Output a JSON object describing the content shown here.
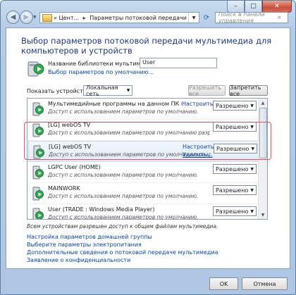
{
  "window": {
    "minimize_glyph": "–",
    "maximize_glyph": "□",
    "close_glyph": "✕"
  },
  "nav": {
    "address_chevrons": "«",
    "address_part1": "Цент...",
    "address_part2": "Параметры потоковой передачи мультимедиа",
    "search_placeholder": "Поиск в панели управления"
  },
  "heading": "Выбор параметров потоковой передачи мультимедиа для компьютеров и устройств",
  "library": {
    "name_label": "Название библиотеки мультимедиа:",
    "name_value": "User",
    "defaults_link": "Выбор параметров по умолчанию..."
  },
  "filter": {
    "show_label": "Показать устройства на:",
    "network_value": "Локальная сеть",
    "allow_all": "Разрешить все",
    "block_all": "Запретить все"
  },
  "devices": [
    {
      "name": "Мультимедийные программы на данном ПК и удален...",
      "desc": "Доступ с использованием параметров по умолчанию.",
      "link1": "Настроить...",
      "link2": "",
      "status": "Разрешено",
      "icon": "pc-stream-icon"
    },
    {
      "name": "[LG] webOS TV",
      "desc": "Доступ с использованием параметров по умолчанию разрешен.",
      "link1": "",
      "link2": "",
      "status": "Разрешено",
      "icon": "tv-icon"
    },
    {
      "name": "[LG] webOS TV",
      "desc": "Доступ с использованием параметров по умолчанию разрешен.",
      "link1": "Настроить...",
      "link2": "Удалить...",
      "status": "Разрешено",
      "icon": "tv-icon"
    },
    {
      "name": "LGPC User (HOME)",
      "desc": "Доступ с использованием параметров по умолчанию.",
      "link1": "",
      "link2": "",
      "status": "Разрешено",
      "icon": "pc-stream-icon"
    },
    {
      "name": "MAINWORK",
      "desc": "Доступ с использованием параметров по умолчанию.",
      "link1": "",
      "link2": "",
      "status": "Разрешено",
      "icon": "pc-stream-icon"
    },
    {
      "name": "User (TRADE : Windows Media Player)",
      "desc": "Доступ с использованием параметров по умолчанию.",
      "link1": "",
      "link2": "",
      "status": "Разрешено",
      "icon": "pc-stream-icon"
    }
  ],
  "note": "Всем устройствам разрешен доступ к общим файлам мультимедиа.",
  "links": [
    "Настройка параметров домашней группы",
    "Выберите параметры электропитания",
    "Дополнительные сведения о потоковой передаче мультимедиа",
    "Заявление о конфиденциальности"
  ],
  "footer": {
    "ok": "OK",
    "cancel": "Отмена"
  },
  "colors": {
    "heading": "#1e3a8a",
    "link": "#0645ad",
    "highlight_box": "#e8544f"
  }
}
